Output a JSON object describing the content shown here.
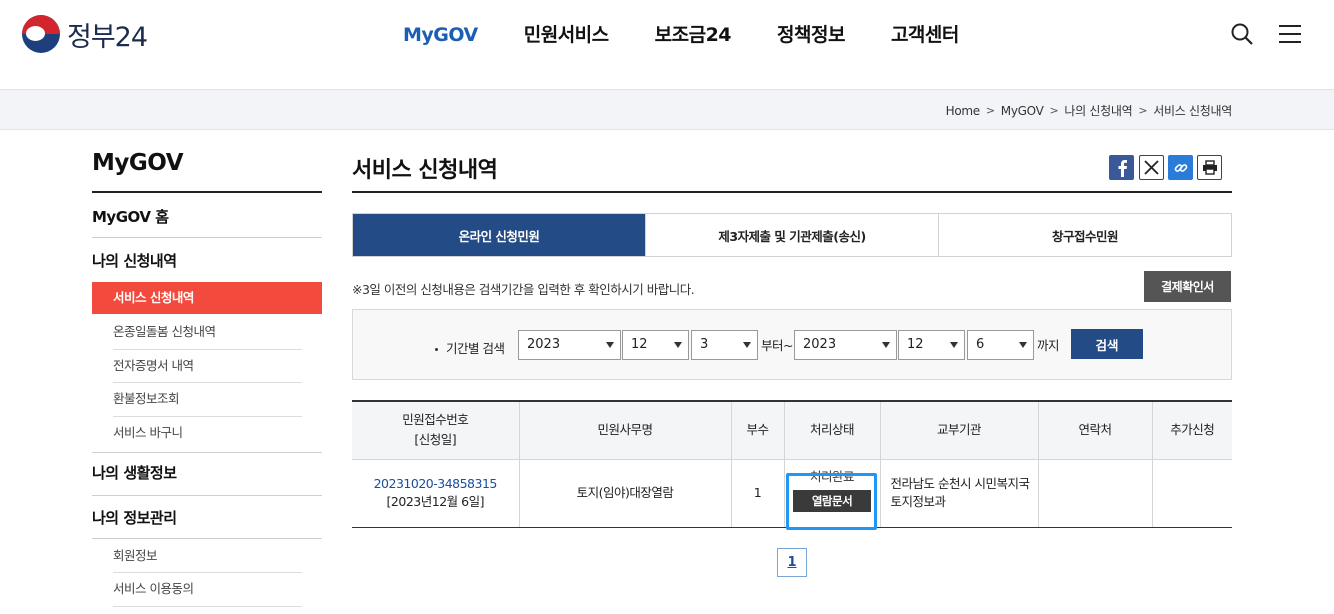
{
  "header": {
    "logo_text": "정부24",
    "nav": [
      "MyGOV",
      "민원서비스",
      "보조금24",
      "정책정보",
      "고객센터"
    ],
    "active_nav": 0
  },
  "breadcrumb": [
    "Home",
    "MyGOV",
    "나의 신청내역",
    "서비스 신청내역"
  ],
  "sidebar": {
    "title": "MyGOV",
    "home": "MyGOV 홈",
    "section1": "나의 신청내역",
    "section1_items": [
      "서비스 신청내역",
      "온종일돌봄 신청내역",
      "전자증명서 내역",
      "환불정보조회",
      "서비스 바구니"
    ],
    "section2": "나의 생활정보",
    "section3": "나의 정보관리",
    "section3_items": [
      "회원정보",
      "서비스 이용동의"
    ]
  },
  "main": {
    "title": "서비스 신청내역",
    "tabs": [
      "온라인 신청민원",
      "제3자제출 및 기관제출(송신)",
      "창구접수민원"
    ],
    "active_tab": 0,
    "notice": "※3일 이전의 신청내용은 검색기간을 입력한 후 확인하시기 바랍니다.",
    "pay_button": "결제확인서",
    "search": {
      "label": "기간별 검색",
      "from_year": "2023",
      "from_month": "12",
      "from_day": "3",
      "from_suffix": "부터~",
      "to_year": "2023",
      "to_month": "12",
      "to_day": "6",
      "to_suffix": "까지",
      "button": "검색"
    },
    "table": {
      "headers": {
        "receipt_line1": "민원접수번호",
        "receipt_line2": "[신청일]",
        "service": "민원사무명",
        "copies": "부수",
        "status": "처리상태",
        "agency": "교부기관",
        "contact": "연락처",
        "extra": "추가신청"
      },
      "rows": [
        {
          "receipt_no": "20231020-34858315",
          "date": "[2023년12월 6일]",
          "service": "토지(임야)대장열람",
          "copies": "1",
          "status": "처리완료",
          "view_button": "열람문서",
          "agency_line1": "전라남도 순천시 시민복지국",
          "agency_line2": "토지정보과",
          "contact": "",
          "extra": ""
        }
      ]
    },
    "pagination": {
      "current": "1"
    }
  },
  "colors": {
    "brand_blue": "#234b86",
    "nav_active": "#1a5fb4",
    "sidebar_active": "#f24a3c",
    "highlight": "#2196f3"
  }
}
